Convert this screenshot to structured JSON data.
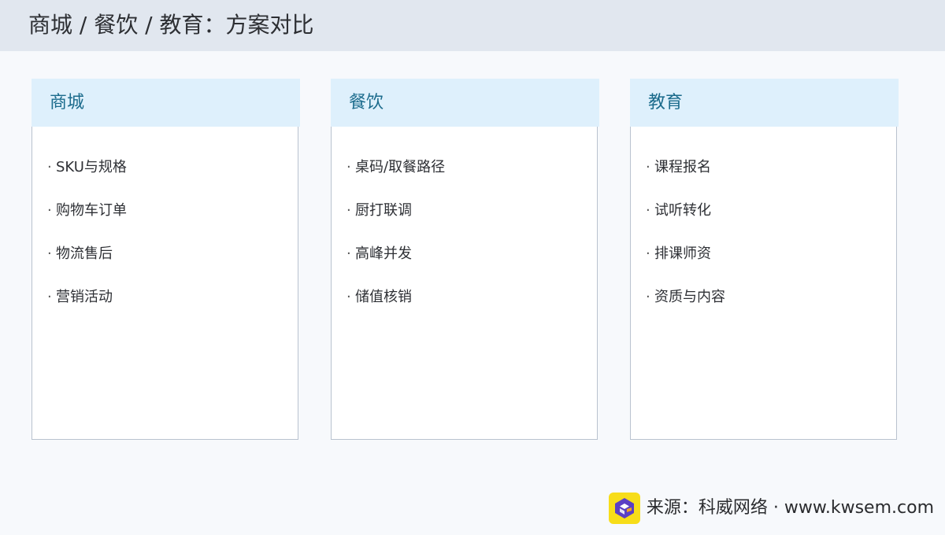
{
  "header": {
    "title": "商城 / 餐饮 / 教育：方案对比"
  },
  "cards": [
    {
      "title": "商城",
      "bullet": "·",
      "items": [
        "SKU与规格",
        "购物车订单",
        "物流售后",
        "营销活动"
      ]
    },
    {
      "title": "餐饮",
      "bullet": "·",
      "items": [
        "桌码/取餐路径",
        "厨打联调",
        "高峰并发",
        "储值核销"
      ]
    },
    {
      "title": "教育",
      "bullet": "·",
      "items": [
        "课程报名",
        "试听转化",
        "排课师资",
        "资质与内容"
      ]
    }
  ],
  "footer": {
    "logo_icon": "kwsem-logo-icon",
    "source_text": "来源：科威网络 · www.kwsem.com"
  },
  "colors": {
    "header_bg": "#e1e7ef",
    "card_header_bg": "#def0fc",
    "card_title": "#1b6b8c",
    "logo_bg": "#f7dd19",
    "logo_mark": "#5b3fc4"
  }
}
